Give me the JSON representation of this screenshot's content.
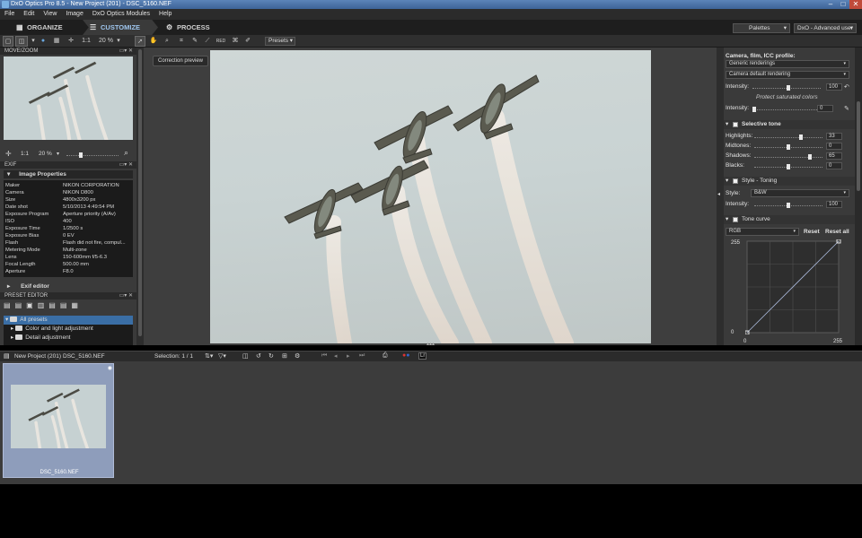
{
  "window": {
    "title": "DxO Optics Pro 8.5 - New Project (201) - DSC_5160.NEF"
  },
  "menu": [
    "File",
    "Edit",
    "View",
    "Image",
    "DxO Optics Modules",
    "Help"
  ],
  "tabs": [
    {
      "label": "ORGANIZE"
    },
    {
      "label": "CUSTOMIZE"
    },
    {
      "label": "PROCESS"
    }
  ],
  "toolbar": {
    "ratio": "1:1",
    "zoom": "20 %",
    "presets": "Presets",
    "palettes": "Palettes",
    "workspace": "DxO - Advanced user"
  },
  "move_zoom": {
    "title": "MOVE/ZOOM",
    "ratio": "1:1",
    "zoom": "20 %"
  },
  "exif": {
    "title": "EXIF",
    "section": "Image Properties",
    "rows": [
      {
        "k": "Maker",
        "v": "NIKON CORPORATION"
      },
      {
        "k": "Camera",
        "v": "NIKON D800"
      },
      {
        "k": "Size",
        "v": "4800x3200 px"
      },
      {
        "k": "Date shot",
        "v": "5/10/2013 4:49:54 PM"
      },
      {
        "k": "Exposure Program",
        "v": "Aperture priority (A/Av)"
      },
      {
        "k": "ISO",
        "v": "400"
      },
      {
        "k": "Exposure Time",
        "v": "1/2500 s"
      },
      {
        "k": "Exposure Bias",
        "v": "0 EV"
      },
      {
        "k": "Flash",
        "v": "Flash did not fire, compul..."
      },
      {
        "k": "Metering Mode",
        "v": "Multi-zone"
      },
      {
        "k": "Lens",
        "v": "150-600mm f/5-6.3"
      },
      {
        "k": "Focal Length",
        "v": "500.00 mm"
      },
      {
        "k": "Aperture",
        "v": "F8.0"
      }
    ],
    "editor": "Exif editor"
  },
  "preset_editor": {
    "title": "PRESET EDITOR",
    "items": [
      "All presets",
      "Color and light adjustment",
      "Detail adjustment"
    ]
  },
  "viewer": {
    "correction_preview": "Correction preview"
  },
  "right": {
    "profile_label": "Camera, film, ICC profile:",
    "profile_value": "Generic renderings",
    "rendering_value": "Camera default rendering",
    "intensity_label": "Intensity:",
    "intensity1": "100",
    "protect_label": "Protect saturated colors",
    "intensity2": "0",
    "selective_tone": {
      "title": "Selective tone",
      "rows": [
        {
          "label": "Highlights:",
          "value": "33"
        },
        {
          "label": "Midtones:",
          "value": "0"
        },
        {
          "label": "Shadows:",
          "value": "65"
        },
        {
          "label": "Blacks:",
          "value": "0"
        }
      ]
    },
    "style_toning": {
      "title": "Style - Toning",
      "style_label": "Style:",
      "style_value": "B&W",
      "intensity": "100"
    },
    "tone_curve": {
      "title": "Tone curve",
      "channel": "RGB",
      "reset": "Reset",
      "reset_all": "Reset all",
      "y_max": "255",
      "y_min": "0",
      "x_min": "0",
      "x_max": "255"
    }
  },
  "statusbar": {
    "project": "New Project (201)",
    "file": "DSC_5160.NEF",
    "selection": "Selection: 1 / 1"
  },
  "filmstrip": {
    "filename": "DSC_5160.NEF"
  }
}
